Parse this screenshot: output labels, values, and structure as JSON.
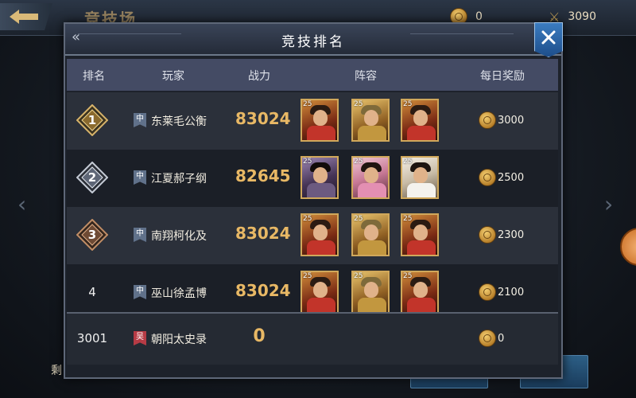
{
  "background": {
    "title": "竞技场",
    "resource_1": "0",
    "resource_2": "3090",
    "left_text": "剩"
  },
  "dialog": {
    "title": "竞技排名",
    "columns": [
      "排名",
      "玩家",
      "战力",
      "阵容",
      "每日奖励"
    ]
  },
  "rows": [
    {
      "rank": "1",
      "server": "中",
      "name": "东莱毛公衡",
      "power": "83024",
      "heroes": [
        {
          "lvl": "25",
          "style": "red"
        },
        {
          "lvl": "25",
          "style": "gold"
        },
        {
          "lvl": "25",
          "style": "red"
        }
      ],
      "reward": "3000"
    },
    {
      "rank": "2",
      "server": "中",
      "name": "江夏郝子纲",
      "power": "82645",
      "heroes": [
        {
          "lvl": "25",
          "style": "purple"
        },
        {
          "lvl": "25",
          "style": "pink"
        },
        {
          "lvl": "25",
          "style": "white"
        }
      ],
      "reward": "2500"
    },
    {
      "rank": "3",
      "server": "中",
      "name": "南翔柯化及",
      "power": "83024",
      "heroes": [
        {
          "lvl": "25",
          "style": "red"
        },
        {
          "lvl": "25",
          "style": "gold"
        },
        {
          "lvl": "25",
          "style": "red"
        }
      ],
      "reward": "2300"
    },
    {
      "rank": "4",
      "server": "中",
      "name": "巫山徐孟博",
      "power": "83024",
      "heroes": [
        {
          "lvl": "25",
          "style": "red"
        },
        {
          "lvl": "25",
          "style": "gold"
        },
        {
          "lvl": "25",
          "style": "red"
        }
      ],
      "reward": "2100"
    }
  ],
  "my_row": {
    "rank": "3001",
    "server": "吴",
    "name": "朝阳太史录",
    "power": "0",
    "reward": "0"
  },
  "colors": {
    "gold": "#e8b865",
    "header_bg": "#444b64",
    "panel_bg": "#1d222b",
    "close_blue": "#3b7cc0"
  }
}
